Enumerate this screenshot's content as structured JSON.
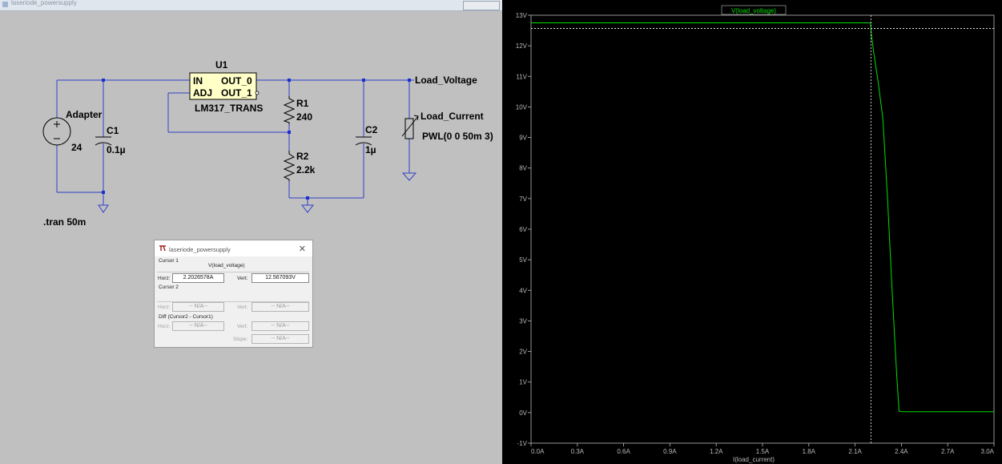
{
  "schematic": {
    "window_title": "laseriode_powersupply",
    "components": {
      "u1_name": "U1",
      "u1_model": "LM317_TRANS",
      "u1_pin_in": "IN",
      "u1_pin_adj": "ADJ",
      "u1_pin_out0": "OUT_0",
      "u1_pin_out1": "OUT_1",
      "adapter_name": "Adapter",
      "adapter_value": "24",
      "c1_name": "C1",
      "c1_value": "0.1µ",
      "r1_name": "R1",
      "r1_value": "240",
      "r2_name": "R2",
      "r2_value": "2.2k",
      "c2_name": "C2",
      "c2_value": "1µ",
      "load_voltage_label": "Load_Voltage",
      "load_current_name": "Load_Current",
      "load_current_value": "PWL(0 0 50m 3)"
    },
    "directive": ".tran 50m"
  },
  "cursor_dialog": {
    "title": "laseriode_powersupply",
    "cursor1_label": "Cursor 1",
    "cursor1_trace": "V(load_voltage)",
    "horz_label": "Horz:",
    "vert_label": "Vert:",
    "cursor1_horz": "2.2026578A",
    "cursor1_vert": "12.567093V",
    "cursor2_label": "Cursor 2",
    "cursor2_horz": "-- N/A--",
    "cursor2_vert": "-- N/A--",
    "diff_label": "Diff (Cursor2 - Cursor1)",
    "diff_horz": "-- N/A--",
    "diff_vert": "-- N/A--",
    "slope_label": "Slope:",
    "diff_slope": "-- N/A--"
  },
  "waveform": {
    "trace_label": "V(load_voltage)",
    "trace_color": "#00e000",
    "cursor_x": 2.2026578,
    "cursor_y": 12.567093
  },
  "chart_data": {
    "type": "line",
    "title": "",
    "xlabel": "I(load_current)",
    "ylabel": "",
    "xlim": [
      0,
      3.0
    ],
    "ylim": [
      -1,
      13
    ],
    "x_ticks": [
      "0.0A",
      "0.3A",
      "0.6A",
      "0.9A",
      "1.2A",
      "1.5A",
      "1.8A",
      "2.1A",
      "2.4A",
      "2.7A",
      "3.0A"
    ],
    "x_tick_values": [
      0,
      0.3,
      0.6,
      0.9,
      1.2,
      1.5,
      1.8,
      2.1,
      2.4,
      2.7,
      3.0
    ],
    "y_ticks": [
      "-1V",
      "0V",
      "1V",
      "2V",
      "3V",
      "4V",
      "5V",
      "6V",
      "7V",
      "8V",
      "9V",
      "10V",
      "11V",
      "12V",
      "13V"
    ],
    "y_tick_values": [
      -1,
      0,
      1,
      2,
      3,
      4,
      5,
      6,
      7,
      8,
      9,
      10,
      11,
      12,
      13
    ],
    "grid": false,
    "series": [
      {
        "name": "V(load_voltage)",
        "color": "#00e000",
        "x": [
          0,
          2.2,
          2.205,
          2.22,
          2.25,
          2.28,
          2.31,
          2.34,
          2.37,
          2.385,
          2.4,
          3.0
        ],
        "y": [
          12.75,
          12.75,
          12.4,
          11.8,
          10.8,
          9.6,
          7.0,
          4.0,
          1.2,
          0.05,
          0.03,
          0.03
        ]
      }
    ]
  }
}
